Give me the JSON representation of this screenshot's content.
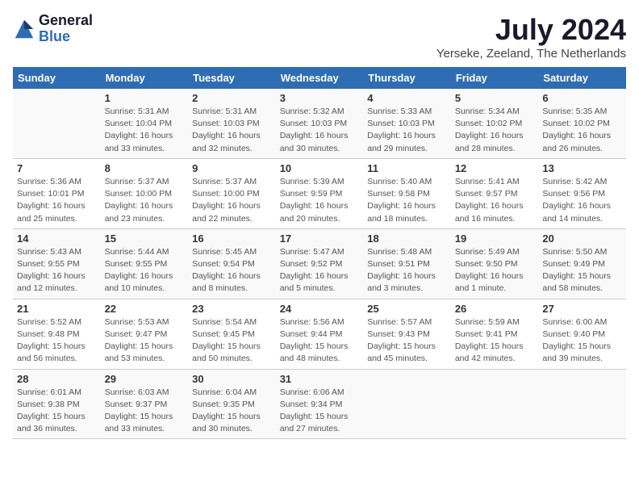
{
  "logo": {
    "general": "General",
    "blue": "Blue"
  },
  "title": "July 2024",
  "subtitle": "Yerseke, Zeeland, The Netherlands",
  "days_of_week": [
    "Sunday",
    "Monday",
    "Tuesday",
    "Wednesday",
    "Thursday",
    "Friday",
    "Saturday"
  ],
  "weeks": [
    [
      {
        "num": "",
        "info": ""
      },
      {
        "num": "1",
        "info": "Sunrise: 5:31 AM\nSunset: 10:04 PM\nDaylight: 16 hours\nand 33 minutes."
      },
      {
        "num": "2",
        "info": "Sunrise: 5:31 AM\nSunset: 10:03 PM\nDaylight: 16 hours\nand 32 minutes."
      },
      {
        "num": "3",
        "info": "Sunrise: 5:32 AM\nSunset: 10:03 PM\nDaylight: 16 hours\nand 30 minutes."
      },
      {
        "num": "4",
        "info": "Sunrise: 5:33 AM\nSunset: 10:03 PM\nDaylight: 16 hours\nand 29 minutes."
      },
      {
        "num": "5",
        "info": "Sunrise: 5:34 AM\nSunset: 10:02 PM\nDaylight: 16 hours\nand 28 minutes."
      },
      {
        "num": "6",
        "info": "Sunrise: 5:35 AM\nSunset: 10:02 PM\nDaylight: 16 hours\nand 26 minutes."
      }
    ],
    [
      {
        "num": "7",
        "info": "Sunrise: 5:36 AM\nSunset: 10:01 PM\nDaylight: 16 hours\nand 25 minutes."
      },
      {
        "num": "8",
        "info": "Sunrise: 5:37 AM\nSunset: 10:00 PM\nDaylight: 16 hours\nand 23 minutes."
      },
      {
        "num": "9",
        "info": "Sunrise: 5:37 AM\nSunset: 10:00 PM\nDaylight: 16 hours\nand 22 minutes."
      },
      {
        "num": "10",
        "info": "Sunrise: 5:39 AM\nSunset: 9:59 PM\nDaylight: 16 hours\nand 20 minutes."
      },
      {
        "num": "11",
        "info": "Sunrise: 5:40 AM\nSunset: 9:58 PM\nDaylight: 16 hours\nand 18 minutes."
      },
      {
        "num": "12",
        "info": "Sunrise: 5:41 AM\nSunset: 9:57 PM\nDaylight: 16 hours\nand 16 minutes."
      },
      {
        "num": "13",
        "info": "Sunrise: 5:42 AM\nSunset: 9:56 PM\nDaylight: 16 hours\nand 14 minutes."
      }
    ],
    [
      {
        "num": "14",
        "info": "Sunrise: 5:43 AM\nSunset: 9:55 PM\nDaylight: 16 hours\nand 12 minutes."
      },
      {
        "num": "15",
        "info": "Sunrise: 5:44 AM\nSunset: 9:55 PM\nDaylight: 16 hours\nand 10 minutes."
      },
      {
        "num": "16",
        "info": "Sunrise: 5:45 AM\nSunset: 9:54 PM\nDaylight: 16 hours\nand 8 minutes."
      },
      {
        "num": "17",
        "info": "Sunrise: 5:47 AM\nSunset: 9:52 PM\nDaylight: 16 hours\nand 5 minutes."
      },
      {
        "num": "18",
        "info": "Sunrise: 5:48 AM\nSunset: 9:51 PM\nDaylight: 16 hours\nand 3 minutes."
      },
      {
        "num": "19",
        "info": "Sunrise: 5:49 AM\nSunset: 9:50 PM\nDaylight: 16 hours\nand 1 minute."
      },
      {
        "num": "20",
        "info": "Sunrise: 5:50 AM\nSunset: 9:49 PM\nDaylight: 15 hours\nand 58 minutes."
      }
    ],
    [
      {
        "num": "21",
        "info": "Sunrise: 5:52 AM\nSunset: 9:48 PM\nDaylight: 15 hours\nand 56 minutes."
      },
      {
        "num": "22",
        "info": "Sunrise: 5:53 AM\nSunset: 9:47 PM\nDaylight: 15 hours\nand 53 minutes."
      },
      {
        "num": "23",
        "info": "Sunrise: 5:54 AM\nSunset: 9:45 PM\nDaylight: 15 hours\nand 50 minutes."
      },
      {
        "num": "24",
        "info": "Sunrise: 5:56 AM\nSunset: 9:44 PM\nDaylight: 15 hours\nand 48 minutes."
      },
      {
        "num": "25",
        "info": "Sunrise: 5:57 AM\nSunset: 9:43 PM\nDaylight: 15 hours\nand 45 minutes."
      },
      {
        "num": "26",
        "info": "Sunrise: 5:59 AM\nSunset: 9:41 PM\nDaylight: 15 hours\nand 42 minutes."
      },
      {
        "num": "27",
        "info": "Sunrise: 6:00 AM\nSunset: 9:40 PM\nDaylight: 15 hours\nand 39 minutes."
      }
    ],
    [
      {
        "num": "28",
        "info": "Sunrise: 6:01 AM\nSunset: 9:38 PM\nDaylight: 15 hours\nand 36 minutes."
      },
      {
        "num": "29",
        "info": "Sunrise: 6:03 AM\nSunset: 9:37 PM\nDaylight: 15 hours\nand 33 minutes."
      },
      {
        "num": "30",
        "info": "Sunrise: 6:04 AM\nSunset: 9:35 PM\nDaylight: 15 hours\nand 30 minutes."
      },
      {
        "num": "31",
        "info": "Sunrise: 6:06 AM\nSunset: 9:34 PM\nDaylight: 15 hours\nand 27 minutes."
      },
      {
        "num": "",
        "info": ""
      },
      {
        "num": "",
        "info": ""
      },
      {
        "num": "",
        "info": ""
      }
    ]
  ]
}
